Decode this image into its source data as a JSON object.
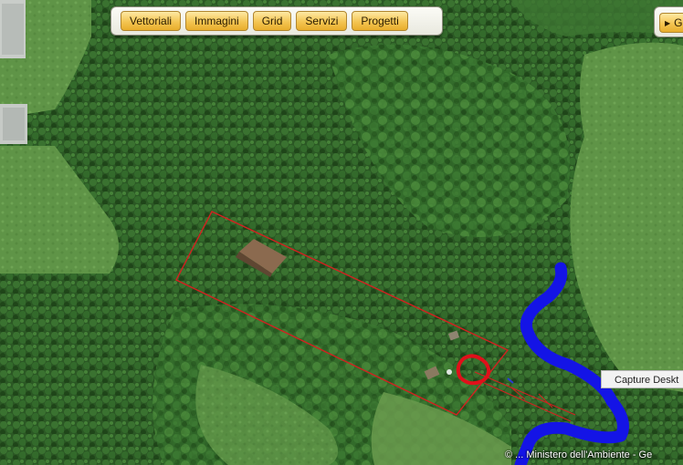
{
  "toolbar": {
    "tabs": [
      {
        "label": "Vettoriali"
      },
      {
        "label": "Immagini"
      },
      {
        "label": "Grid"
      },
      {
        "label": "Servizi"
      },
      {
        "label": "Progetti"
      }
    ]
  },
  "right_panel": {
    "label": "G"
  },
  "tooltip": {
    "text": "Capture Deskt"
  },
  "copyright": {
    "text": "© ... Ministero dell'Ambiente - Ge"
  },
  "colors": {
    "toolbar_tab": "#f4c552",
    "parcel_outline": "#d42020",
    "marker_circle": "#e0101a",
    "river_line": "#1414e6",
    "forest": "#2c5a25",
    "meadow": "#5a8f44"
  }
}
